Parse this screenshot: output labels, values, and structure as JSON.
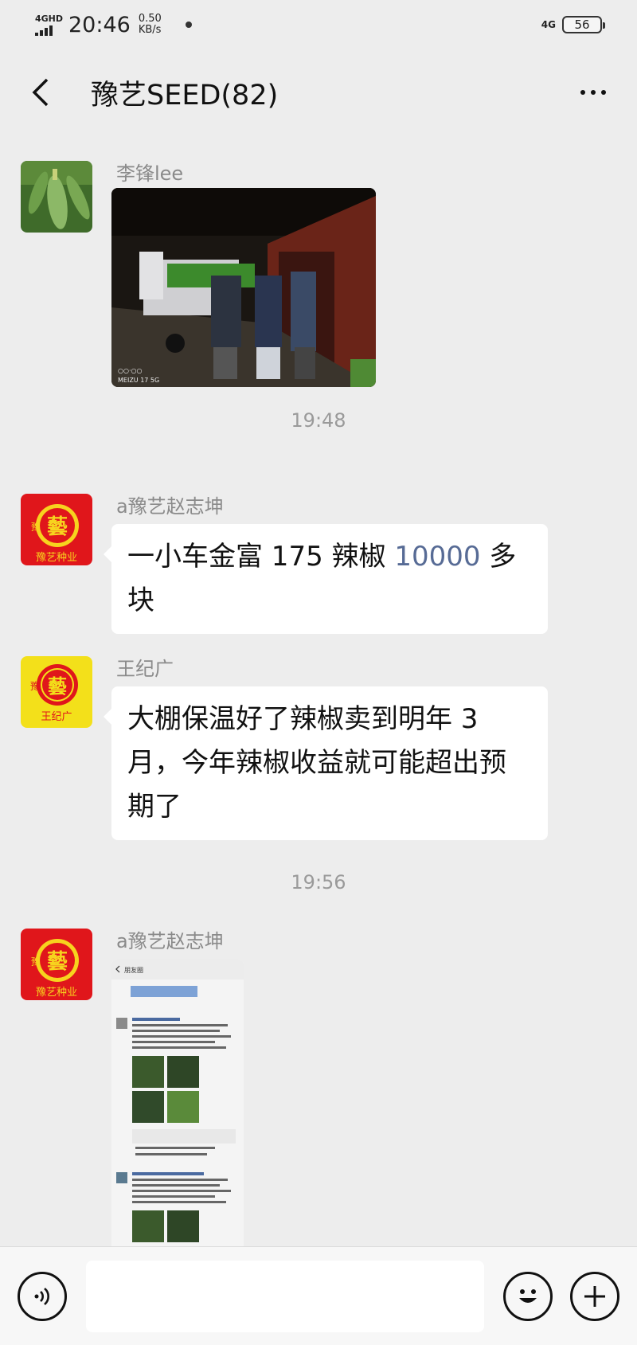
{
  "status_bar": {
    "network": "4GHD",
    "time": "20:46",
    "speed_value": "0.50",
    "speed_unit": "KB/s",
    "network_right": "4G",
    "battery": "56"
  },
  "header": {
    "title": "豫艺SEED(82)",
    "back_icon": "chevron-left-icon",
    "more_icon": "more-dots-icon"
  },
  "messages": [
    {
      "sender": "李锋lee",
      "type": "image",
      "image_caption": "MEIZU 17 5G"
    },
    {
      "timestamp": "19:48"
    },
    {
      "sender": "a豫艺赵志坤",
      "type": "text",
      "text_before": "一小车金富 175 辣椒 ",
      "text_link": "10000",
      "text_after": " 多块",
      "avatar_text": "豫艺种业"
    },
    {
      "sender": "王纪广",
      "type": "text",
      "text": "大棚保温好了辣椒卖到明年 3 月，今年辣椒收益就可能超出预期了",
      "avatar_text": "王纪广"
    },
    {
      "timestamp": "19:56"
    },
    {
      "sender": "a豫艺赵志坤",
      "type": "image",
      "avatar_text": "豫艺种业",
      "screenshot_header": "朋友圈"
    }
  ],
  "input_bar": {
    "voice_icon": "voice-icon",
    "emoji_icon": "emoji-icon",
    "plus_icon": "plus-icon"
  },
  "colors": {
    "background": "#ededed",
    "bubble": "#ffffff",
    "link": "#576b95",
    "logo_red": "#e0161b",
    "logo_yellow": "#f3e01a"
  }
}
